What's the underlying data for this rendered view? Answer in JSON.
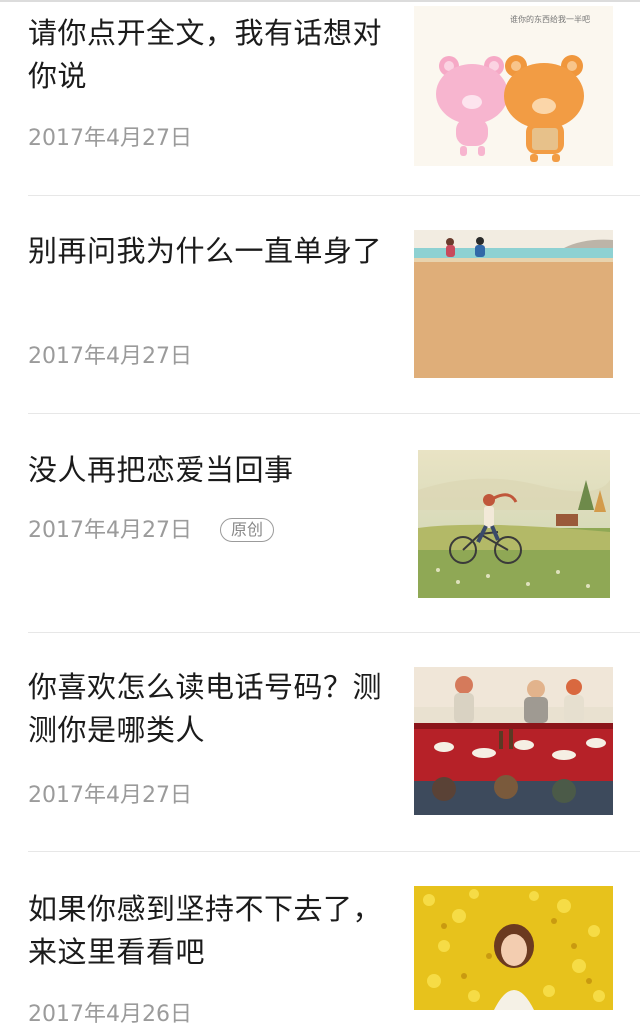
{
  "articles": [
    {
      "title": "请你点开全文，我有话想对你说",
      "date": "2017年4月27日",
      "badge": "",
      "thumb": "two-bears-cartoon",
      "thumb_caption": "谁你的东西给我一半吧"
    },
    {
      "title": "别再问我为什么一直单身了",
      "date": "2017年4月27日",
      "badge": "",
      "thumb": "beach-couple-illustration",
      "thumb_caption": ""
    },
    {
      "title": "没人再把恋爱当回事",
      "date": "2017年4月27日",
      "badge": "原创",
      "thumb": "cyclist-meadow-illustration",
      "thumb_caption": ""
    },
    {
      "title": "你喜欢怎么读电话号码？测测你是哪类人",
      "date": "2017年4月27日",
      "badge": "",
      "thumb": "dinner-table-illustration",
      "thumb_caption": ""
    },
    {
      "title": "如果你感到坚持不下去了，来这里看看吧",
      "date": "2017年4月26日",
      "badge": "",
      "thumb": "girl-in-flowers-illustration",
      "thumb_caption": ""
    }
  ]
}
